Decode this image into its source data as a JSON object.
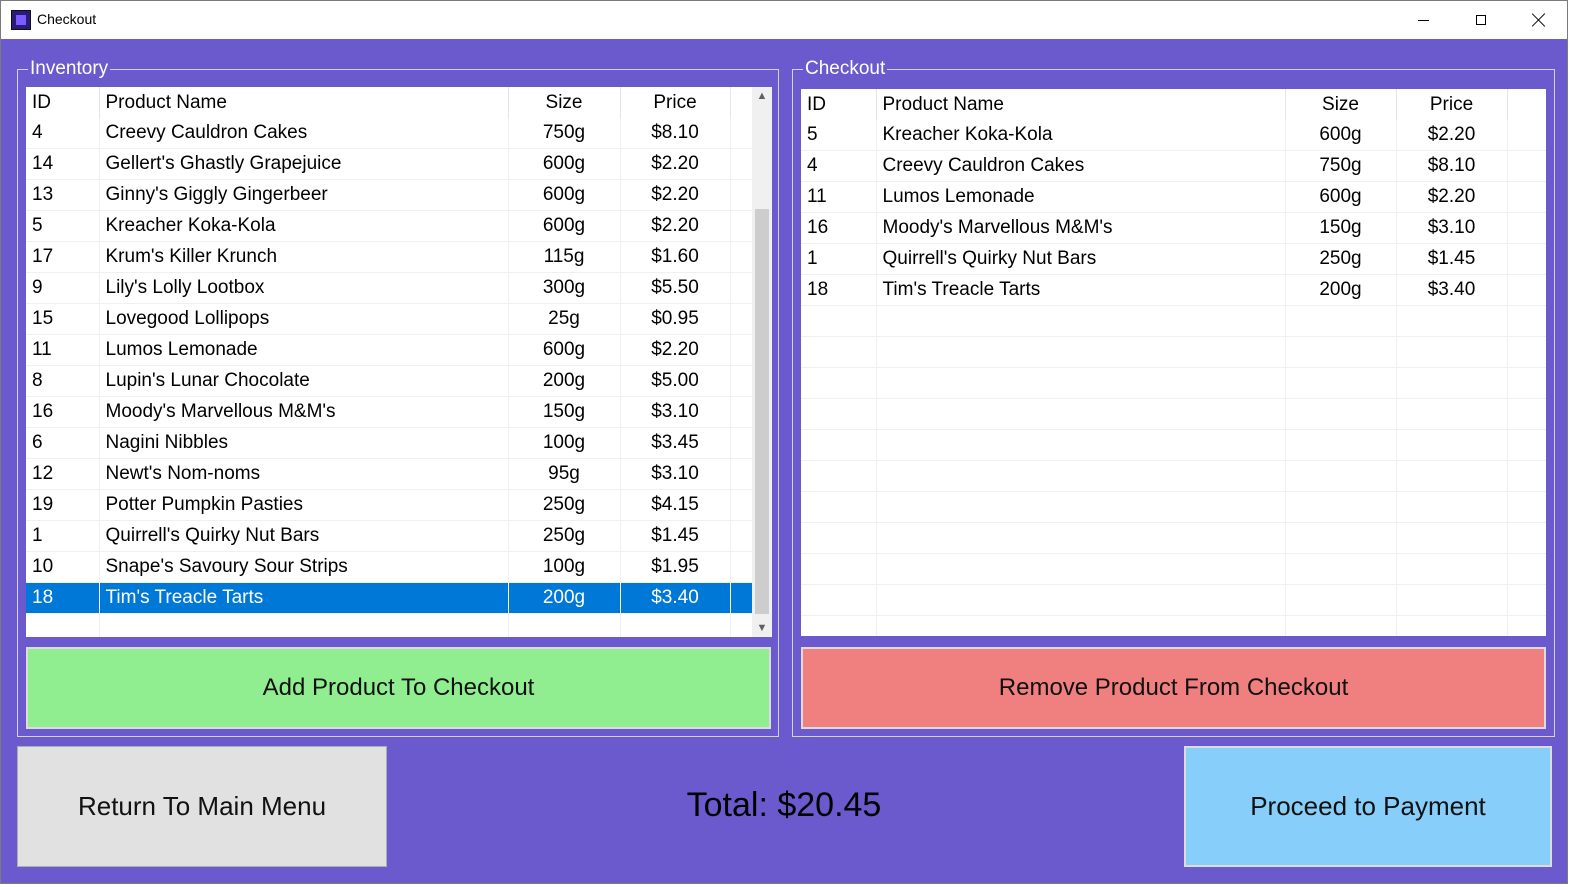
{
  "window": {
    "title": "Checkout"
  },
  "inventory": {
    "label": "Inventory",
    "columns": [
      "ID",
      "Product Name",
      "Size",
      "Price"
    ],
    "rows": [
      [
        "4",
        "Creevy Cauldron Cakes",
        "750g",
        "$8.10"
      ],
      [
        "14",
        "Gellert's Ghastly Grapejuice",
        "600g",
        "$2.20"
      ],
      [
        "13",
        "Ginny's Giggly Gingerbeer",
        "600g",
        "$2.20"
      ],
      [
        "5",
        "Kreacher Koka-Kola",
        "600g",
        "$2.20"
      ],
      [
        "17",
        "Krum's Killer Krunch",
        "115g",
        "$1.60"
      ],
      [
        "9",
        "Lily's Lolly Lootbox",
        "300g",
        "$5.50"
      ],
      [
        "15",
        "Lovegood Lollipops",
        "25g",
        "$0.95"
      ],
      [
        "11",
        "Lumos Lemonade",
        "600g",
        "$2.20"
      ],
      [
        "8",
        "Lupin's Lunar Chocolate",
        "200g",
        "$5.00"
      ],
      [
        "16",
        "Moody's Marvellous M&M's",
        "150g",
        "$3.10"
      ],
      [
        "6",
        "Nagini Nibbles",
        "100g",
        "$3.45"
      ],
      [
        "12",
        "Newt's Nom-noms",
        "95g",
        "$3.10"
      ],
      [
        "19",
        "Potter Pumpkin Pasties",
        "250g",
        "$4.15"
      ],
      [
        "1",
        "Quirrell's Quirky Nut Bars",
        "250g",
        "$1.45"
      ],
      [
        "10",
        "Snape's Savoury Sour Strips",
        "100g",
        "$1.95"
      ],
      [
        "18",
        "Tim's Treacle Tarts",
        "200g",
        "$3.40"
      ]
    ],
    "selected_row_id": "18",
    "add_button": "Add Product To Checkout"
  },
  "checkout": {
    "label": "Checkout",
    "columns": [
      "ID",
      "Product Name",
      "Size",
      "Price"
    ],
    "rows": [
      [
        "5",
        "Kreacher Koka-Kola",
        "600g",
        "$2.20"
      ],
      [
        "4",
        "Creevy Cauldron Cakes",
        "750g",
        "$8.10"
      ],
      [
        "11",
        "Lumos Lemonade",
        "600g",
        "$2.20"
      ],
      [
        "16",
        "Moody's Marvellous M&M's",
        "150g",
        "$3.10"
      ],
      [
        "1",
        "Quirrell's Quirky Nut Bars",
        "250g",
        "$1.45"
      ],
      [
        "18",
        "Tim's Treacle Tarts",
        "200g",
        "$3.40"
      ]
    ],
    "remove_button": "Remove Product From Checkout"
  },
  "footer": {
    "return_button": "Return To Main Menu",
    "total_label": "Total: $20.45",
    "pay_button": "Proceed to Payment"
  },
  "colors": {
    "window_bg": "#6a5acd",
    "add_button": "#90ee90",
    "remove_button": "#f08080",
    "pay_button": "#87cefa",
    "selection": "#0078d7"
  },
  "icons": {
    "app": "app-icon",
    "minimize": "minimize-icon",
    "maximize": "maximize-icon",
    "close": "close-icon",
    "scroll_up": "chevron-up-icon",
    "scroll_down": "chevron-down-icon"
  }
}
